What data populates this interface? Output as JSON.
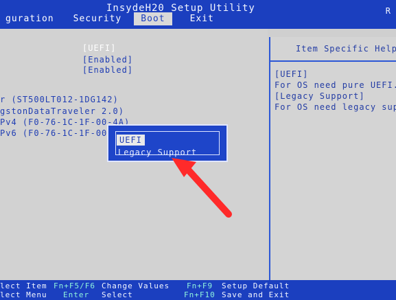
{
  "app": {
    "title": "InsydeH20 Setup Utility",
    "right_indicator": "R"
  },
  "menu": {
    "items": [
      {
        "label": "guration",
        "active": false
      },
      {
        "label": "Security",
        "active": false
      },
      {
        "label": "Boot",
        "active": true
      },
      {
        "label": "Exit",
        "active": false
      }
    ]
  },
  "boot": {
    "settings_values": [
      {
        "value": "[UEFI]",
        "selected": true
      },
      {
        "value": "[Enabled]",
        "selected": false
      },
      {
        "value": "[Enabled]",
        "selected": false
      }
    ],
    "devices": [
      "r (ST500LT012-1DG142)",
      "gstonDataTraveler 2.0)",
      "Pv4 (F0-76-1C-1F-00-4A)",
      "Pv6 (F0-76-1C-1F-00"
    ]
  },
  "popup": {
    "options": [
      "UEFI",
      "Legacy Support"
    ],
    "highlighted_index": 0
  },
  "help": {
    "header": "Item Specific Help",
    "lines": [
      "[UEFI]",
      "For OS need pure UEFI.",
      "[Legacy Support]",
      "For OS need legacy suppor"
    ]
  },
  "bottom": {
    "row1": {
      "left": "lect Item",
      "k1": "Fn+F5/F6",
      "t1": "Change Values",
      "k2": "Fn+F9",
      "t2": "Setup Default"
    },
    "row2": {
      "left": "lect Menu",
      "k1": "Enter",
      "t1": "Select",
      "k2": "Fn+F10",
      "t2": "Save and Exit"
    }
  },
  "colors": {
    "bios_blue": "#1b3fbf",
    "panel_gray": "#cfcfcf",
    "text_blue": "#1f3db3",
    "key_cyan": "#8ff3dc",
    "arrow_red": "#ff2a2a"
  }
}
